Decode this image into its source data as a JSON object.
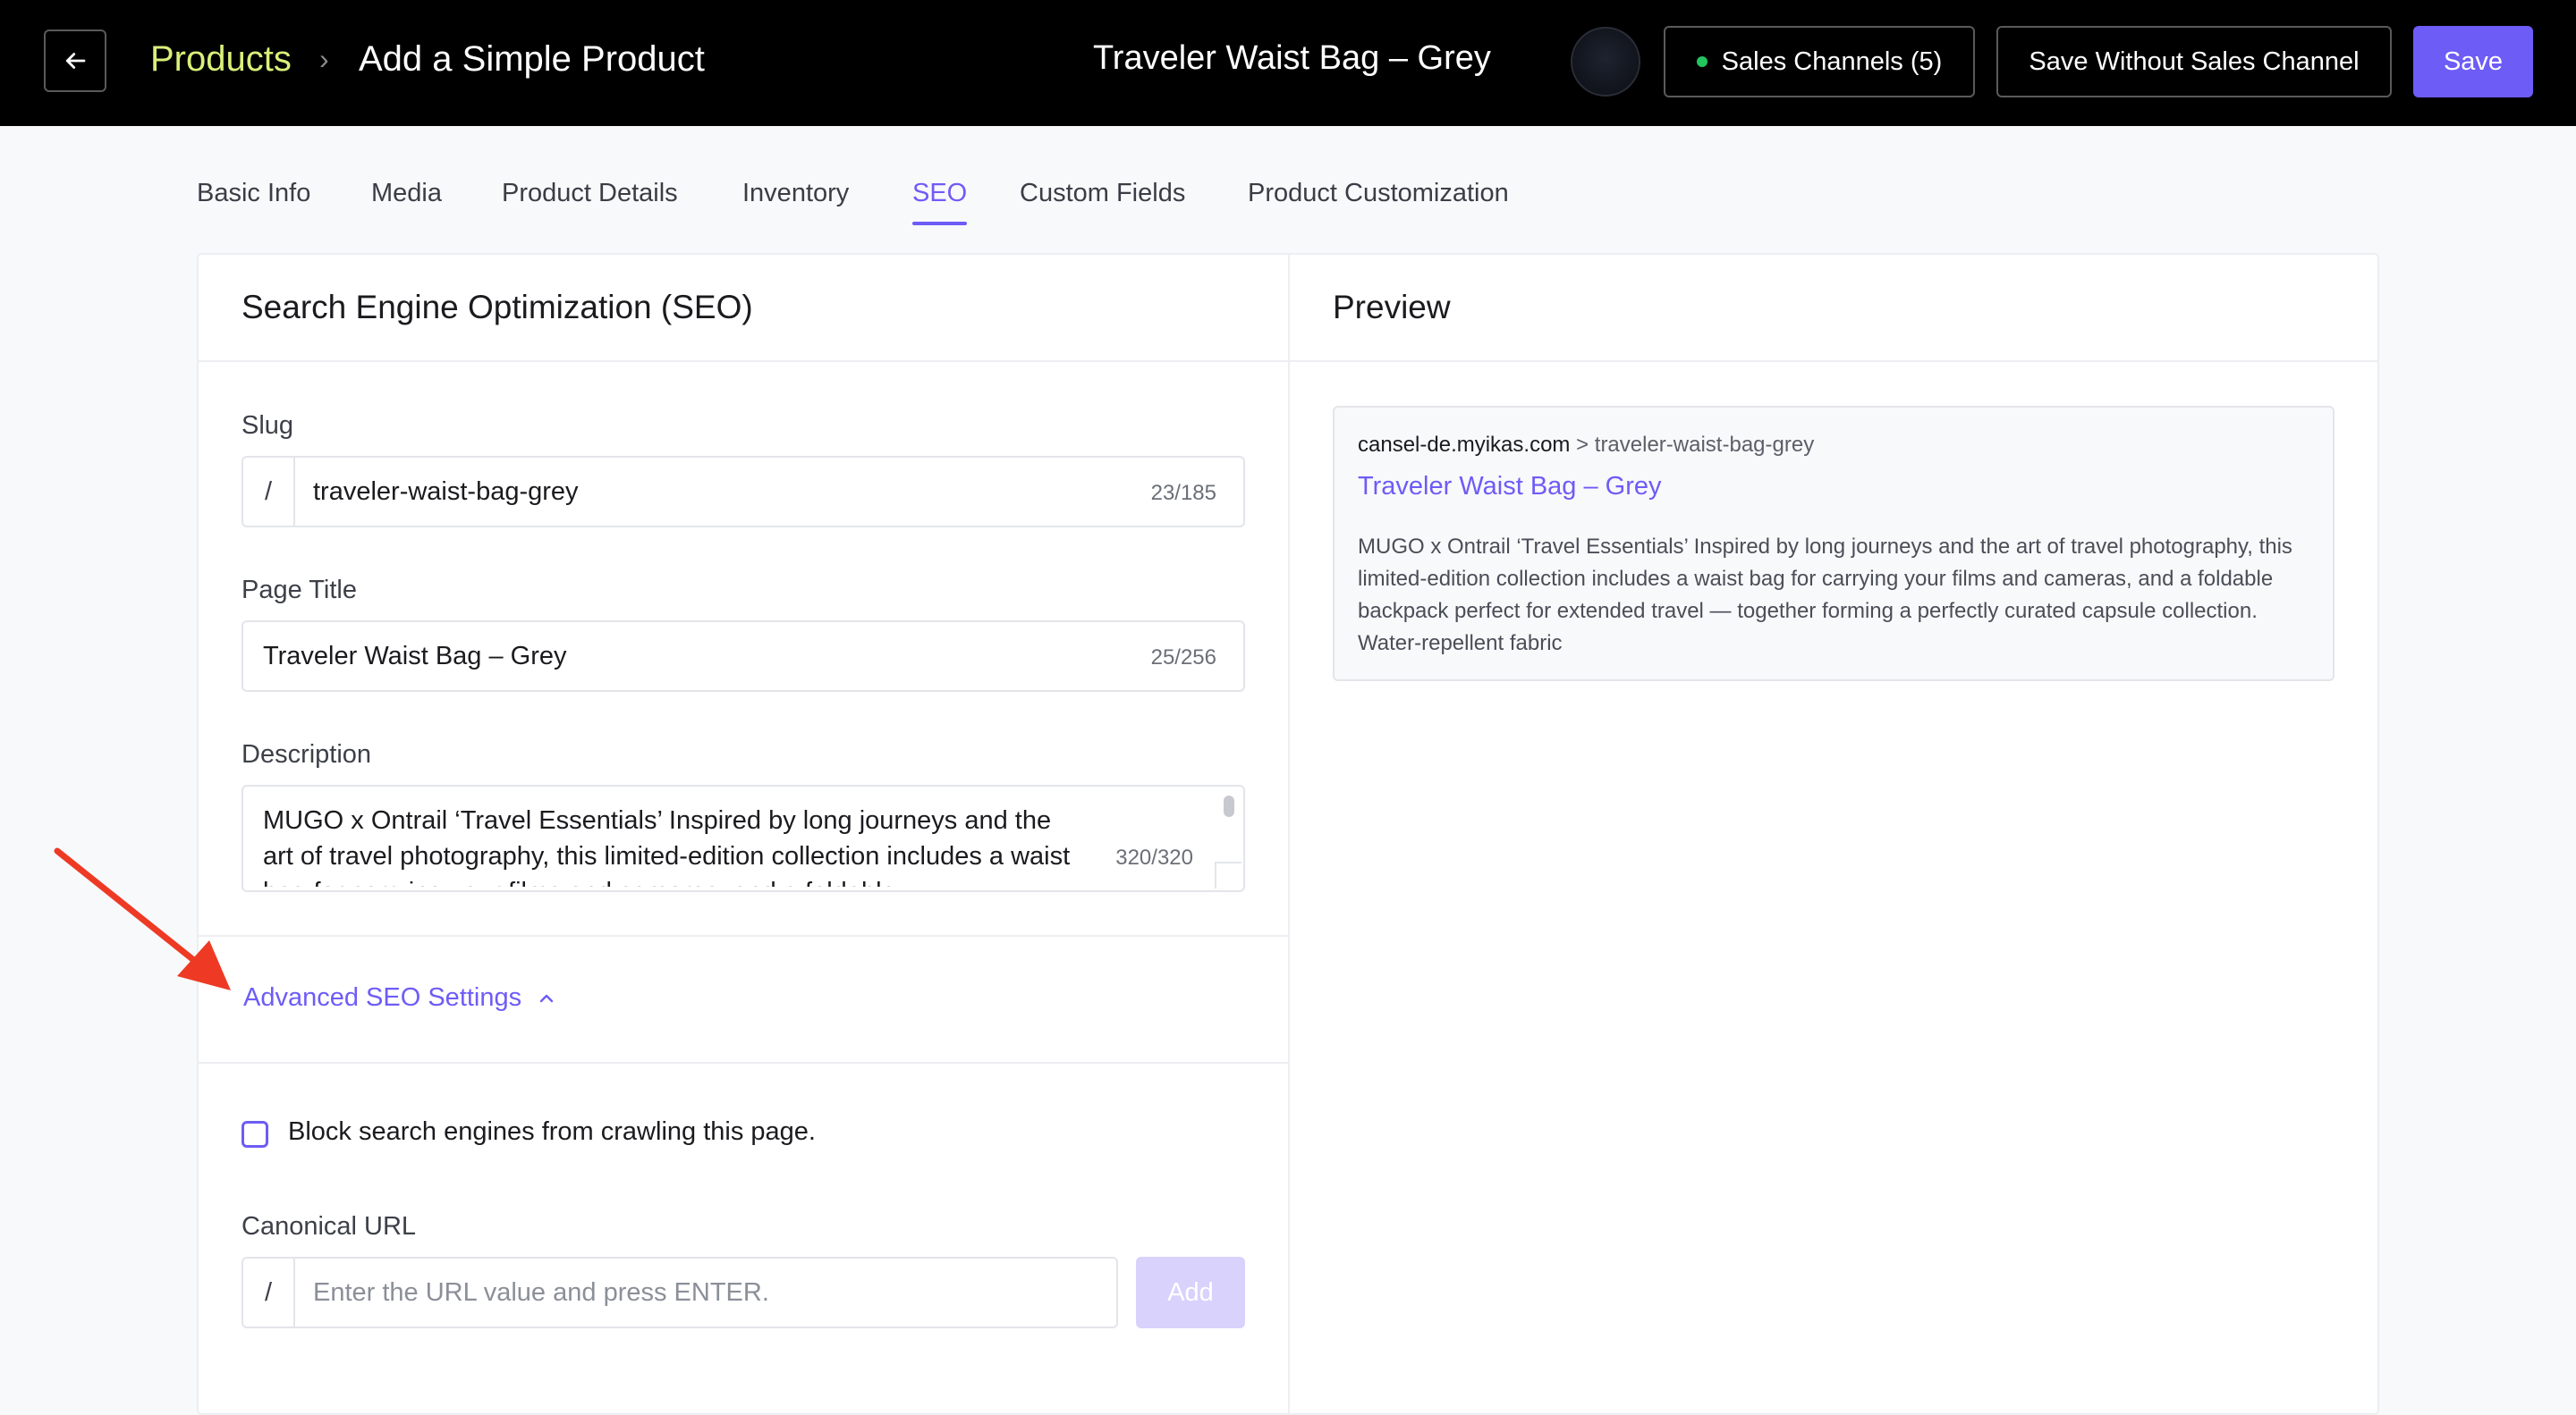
{
  "header": {
    "breadcrumb_parent": "Products",
    "breadcrumb_separator": "›",
    "breadcrumb_current": "Add a Simple Product",
    "product_name": "Traveler Waist Bag – Grey",
    "sales_channels_label": "Sales Channels (5)",
    "save_without_label": "Save Without Sales Channel",
    "save_label": "Save",
    "icons": {
      "back": "arrow-left-icon",
      "avatar": "user-avatar"
    },
    "colors": {
      "breadcrumb_parent": "#d9ef7a",
      "accent": "#6d5cf6",
      "status_dot": "#22c55e"
    }
  },
  "tabs": [
    {
      "label": "Basic Info"
    },
    {
      "label": "Media"
    },
    {
      "label": "Product Details"
    },
    {
      "label": "Inventory"
    },
    {
      "label": "SEO",
      "active": true
    },
    {
      "label": "Custom Fields"
    },
    {
      "label": "Product Customization"
    }
  ],
  "seo": {
    "title": "Search Engine Optimization (SEO)",
    "slug_label": "Slug",
    "slug_prefix": "/",
    "slug_value": "traveler-waist-bag-grey",
    "slug_counter": "23/185",
    "page_title_label": "Page Title",
    "page_title_value": "Traveler Waist Bag – Grey",
    "page_title_counter": "25/256",
    "description_label": "Description",
    "description_value": "MUGO x Ontrail ‘Travel Essentials’ Inspired by long journeys and the art of travel photography, this limited-edition collection includes a waist bag for carrying your films and cameras, and a foldable",
    "description_counter": "320/320",
    "advanced_label": "Advanced SEO Settings",
    "block_label": "Block search engines from crawling this page.",
    "block_checked": false,
    "canonical_label": "Canonical URL",
    "canonical_prefix": "/",
    "canonical_placeholder": "Enter the URL value and press ENTER.",
    "add_label": "Add"
  },
  "preview": {
    "title": "Preview",
    "domain": "cansel-de.myikas.com",
    "path": " > traveler-waist-bag-grey",
    "link_title": "Traveler Waist Bag – Grey",
    "description": "MUGO x Ontrail ‘Travel Essentials’ Inspired by long journeys and the art of travel photography, this limited-edition collection includes a waist bag for carrying your films and cameras, and a foldable backpack perfect for extended travel — together forming a perfectly curated capsule collection. Water-repellent fabric"
  }
}
